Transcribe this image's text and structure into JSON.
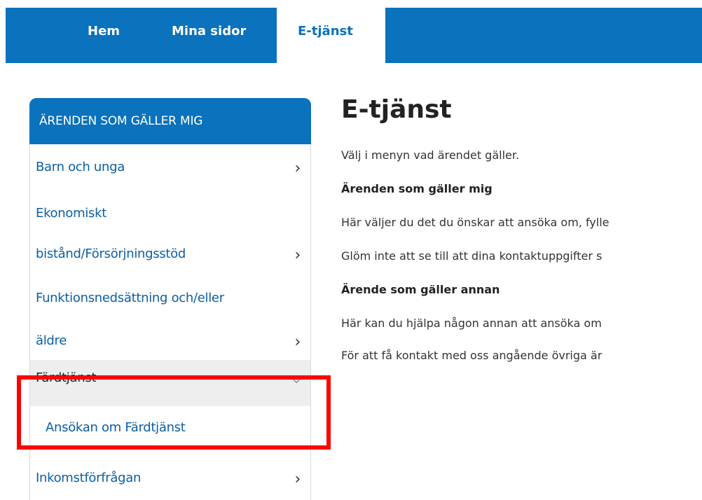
{
  "nav": {
    "home": "Hem",
    "mina_sidor": "Mina sidor",
    "etjanst": "E-tjänst"
  },
  "sidebar": {
    "heading": "ÄRENDEN SOM GÄLLER MIG",
    "items": [
      {
        "lines": [
          "Barn och unga"
        ]
      },
      {
        "lines": [
          "Ekonomiskt",
          "bistånd/Försörjningsstöd"
        ]
      },
      {
        "lines": [
          "Funktionsnedsättning och/eller",
          "äldre"
        ]
      },
      {
        "lines": [
          "Färdtjänst"
        ],
        "expanded": true,
        "subitems": [
          "Ansökan om Färdtjänst"
        ]
      },
      {
        "lines": [
          "Inkomstförfrågan"
        ]
      }
    ]
  },
  "main": {
    "title": "E-tjänst",
    "intro": "Välj i menyn vad ärendet gäller.",
    "section1_heading": "Ärenden som gäller mig",
    "section1_p1": "Här väljer du det du önskar att ansöka om, fylle",
    "section1_p2": "Glöm inte att se till att dina kontaktuppgifter s",
    "section2_heading": "Ärende som gäller annan",
    "section2_p1": "Här kan du hjälpa någon annan att ansöka om",
    "section2_p2": "För att få kontakt med oss angående övriga är"
  },
  "colors": {
    "brand": "#0b72bd",
    "highlight": "#ff0000",
    "expanded_bg": "#eeeeee"
  },
  "icons": {
    "chevron_right": "chevron-right-icon",
    "chevron_down": "chevron-down-icon"
  }
}
